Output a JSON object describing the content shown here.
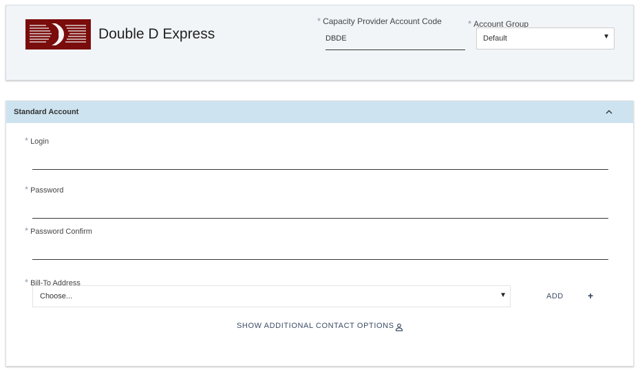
{
  "header": {
    "company_name": "Double D Express",
    "capacity_provider_label": "Capacity Provider Account Code",
    "capacity_provider_value": "DBDE",
    "account_group_label": "Account Group",
    "account_group_value": "Default",
    "required_mark": "*",
    "logo_icon": "double-d-logo-icon",
    "brand_color": "#7a0c0c"
  },
  "section": {
    "title": "Standard Account",
    "header_color": "#cde3ef",
    "collapse_icon": "chevron-up-icon"
  },
  "fields": {
    "login_label": "Login",
    "login_value": "",
    "password_label": "Password",
    "password_value": "",
    "password_confirm_label": "Password Confirm",
    "password_confirm_value": "",
    "bill_to_label": "Bill-To Address",
    "bill_to_value": "Choose..."
  },
  "actions": {
    "add_label": "ADD",
    "add_icon": "plus-icon",
    "show_more_label": "SHOW ADDITIONAL CONTACT OPTIONS",
    "contact_icon": "person-icon"
  },
  "dropdown_caret": "▼"
}
